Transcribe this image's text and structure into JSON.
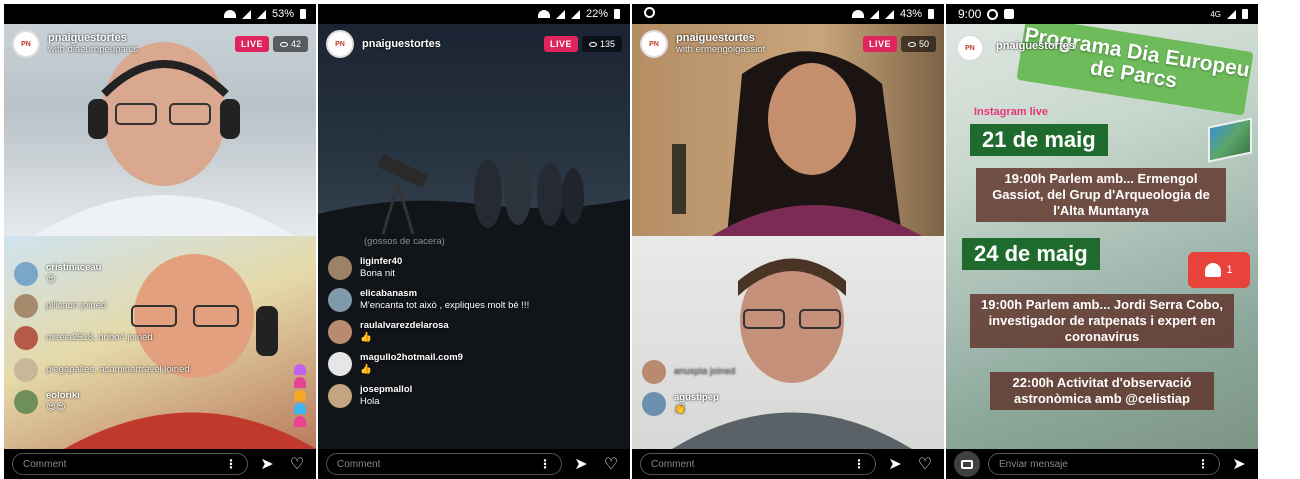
{
  "screens": [
    {
      "status": {
        "battery": "53%"
      },
      "header": {
        "username": "pnaiguestortes",
        "with": "with diaeuropeuparcs",
        "live": "LIVE",
        "viewers": "42"
      },
      "comments": [
        {
          "name": "cristinaceau",
          "text": "😍"
        },
        {
          "name": "",
          "text": "pilicaun joined"
        },
        {
          "name": "",
          "text": "mireia2518, dribo4 joined"
        },
        {
          "name": "",
          "text": "plegapalles, acaminartravel joined"
        },
        {
          "name": "eoloriki",
          "text": "😍😍"
        }
      ],
      "comment_placeholder": "Comment"
    },
    {
      "status": {
        "battery": "22%"
      },
      "header": {
        "username": "pnaiguestortes",
        "live": "LIVE",
        "viewers": "135"
      },
      "faded_text": "(gossos de cacera)",
      "comments": [
        {
          "name": "liginfer40",
          "text": "Bona nit"
        },
        {
          "name": "elicabanasm",
          "text": "M'encanta tot això , expliques molt bé !!!"
        },
        {
          "name": "raulalvarezdelarosa",
          "text": "👍"
        },
        {
          "name": "magullo2hotmail.com9",
          "text": "👍"
        },
        {
          "name": "josepmallol",
          "text": "Hola"
        }
      ],
      "comment_placeholder": "Comment"
    },
    {
      "status": {
        "battery": "43%"
      },
      "header": {
        "username": "pnaiguestortes",
        "with": "with ermengolgassiot",
        "live": "LIVE",
        "viewers": "50"
      },
      "comments": [
        {
          "name": "",
          "text": "anuspia joined"
        },
        {
          "name": "agustipep",
          "text": "👏"
        }
      ],
      "comment_placeholder": "Comment"
    },
    {
      "status": {
        "time": "9:00",
        "network": "4G"
      },
      "username": "pnaiguestortes",
      "poster": {
        "title": "Programa Dia Europeu de Parcs",
        "instagram": "Instagram live",
        "date1": "21 de maig",
        "event1": "19:00h Parlem amb... Ermengol Gassiot, del Grup d'Arqueologia de l'Alta Muntanya",
        "date2": "24 de maig",
        "likes": "1",
        "event2": "19:00h Parlem amb... Jordi Serra Cobo, investigador de ratpenats i expert en coronavirus",
        "event3": "22:00h Activitat d'observació astronòmica amb @celistiap"
      },
      "message_placeholder": "Enviar mensaje"
    }
  ],
  "colors": {
    "live": "#e0245e",
    "poster_green": "#1f6b2e",
    "poster_title": "#6dbb5b",
    "poster_box": "#5f3228",
    "heart": "#e8433a"
  }
}
